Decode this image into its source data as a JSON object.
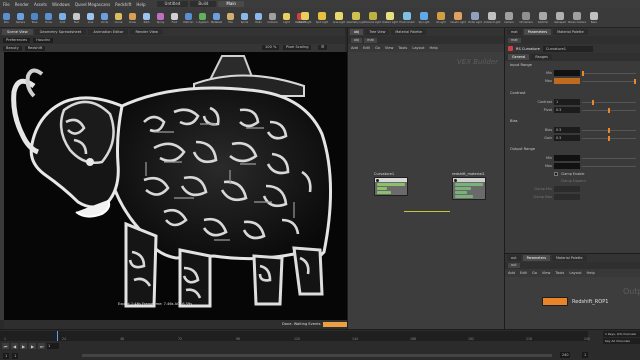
{
  "menubar": {
    "items": [
      "File",
      "Render",
      "Assets",
      "Windows",
      "Qunel Megascans",
      "Redshift",
      "Help"
    ],
    "tabs": [
      "Untitled",
      "Build",
      "Main"
    ]
  },
  "shelf": {
    "tools": [
      {
        "label": "Box",
        "icon": "box-icon",
        "color": "#5a8fd0"
      },
      {
        "label": "Sphere",
        "icon": "sphere-icon",
        "color": "#6aa0e0"
      },
      {
        "label": "Tube",
        "icon": "tube-icon",
        "color": "#4f86c8"
      },
      {
        "label": "Torus",
        "icon": "torus-icon",
        "color": "#5a8fd0"
      },
      {
        "label": "Grid",
        "icon": "grid-icon",
        "color": "#7ab0e8"
      },
      {
        "label": "Null",
        "icon": "null-icon",
        "color": "#c8c8c8"
      },
      {
        "label": "Line",
        "icon": "line-icon",
        "color": "#9cc4ee"
      },
      {
        "label": "Circle",
        "icon": "circle-icon",
        "color": "#6aa0e0"
      },
      {
        "label": "Curve",
        "icon": "curve-icon",
        "color": "#d8c060"
      },
      {
        "label": "Draw",
        "icon": "draw-icon",
        "color": "#d8a050"
      },
      {
        "label": "Path",
        "icon": "path-icon",
        "color": "#9cc4ee"
      },
      {
        "label": "Spray",
        "icon": "spray-icon",
        "color": "#c070c0"
      },
      {
        "label": "Font",
        "icon": "font-icon",
        "color": "#d0d0d0"
      },
      {
        "label": "Platonic",
        "icon": "platonic-icon",
        "color": "#5a8fd0"
      },
      {
        "label": "L-System",
        "icon": "lsystem-icon",
        "color": "#60b060"
      },
      {
        "label": "Metaball",
        "icon": "metaball-icon",
        "color": "#6aa0e0"
      },
      {
        "label": "File",
        "icon": "file-icon",
        "color": "#d0b070"
      },
      {
        "label": "Spiral",
        "icon": "spiral-icon",
        "color": "#8ab8e8"
      },
      {
        "label": "Helix",
        "icon": "helix-icon",
        "color": "#8ab8e8"
      },
      {
        "label": "Camera",
        "icon": "camera-icon",
        "color": "#a0a0a0"
      },
      {
        "label": "Light",
        "icon": "light-icon",
        "color": "#e8d060"
      },
      {
        "label": "Redshift",
        "icon": "redshift-icon",
        "color": "#d04040"
      }
    ],
    "right_tools": [
      {
        "label": "Point Light",
        "color": "#e8d060"
      },
      {
        "label": "Spot Light",
        "color": "#e8c040"
      },
      {
        "label": "Area Light",
        "color": "#e8d870"
      },
      {
        "label": "Geometry Light",
        "color": "#d0c050"
      },
      {
        "label": "Volume Light",
        "color": "#c0b040"
      },
      {
        "label": "Distant Light",
        "color": "#e8e080"
      },
      {
        "label": "Environment",
        "color": "#80c0e0"
      },
      {
        "label": "Sky Light",
        "color": "#60a8e8"
      },
      {
        "label": "GI Light",
        "color": "#d0a040"
      },
      {
        "label": "Caustic Light",
        "color": "#e0a060"
      },
      {
        "label": "Portal Light",
        "color": "#90a0c0"
      },
      {
        "label": "Ambient Light",
        "color": "#c0c0c0"
      },
      {
        "label": "Camera",
        "color": "#a0a0a0"
      },
      {
        "label": "VR Camera",
        "color": "#909090"
      },
      {
        "label": "Switcher",
        "color": "#a8a8a8"
      },
      {
        "label": "Gamepad",
        "color": "#b0b0b0"
      },
      {
        "label": "Stereo Camera",
        "color": "#a0a0a0"
      },
      {
        "label": "Basic",
        "color": "#c0c0c0"
      }
    ]
  },
  "viewport": {
    "tabs": [
      "Scene View",
      "Geometry Spreadsheet",
      "Animation Editor",
      "Render View"
    ],
    "address": [
      "Preferences",
      "Houdini"
    ],
    "camera": "Beauty",
    "aov": "Redshift",
    "zoom": "100 %",
    "scaling": "Pixel Scaling",
    "caption": "Export 1:46s  Frametime: 7.46s  AO: 6.59s",
    "status": "Done. Waiting Events",
    "progress": 1.0
  },
  "timeline": {
    "ticks": [
      "1",
      "24",
      "48",
      "72",
      "96",
      "120",
      "144",
      "168",
      "192",
      "216",
      "240"
    ],
    "frame": "1",
    "start": "1",
    "end": "1",
    "range_start": "1",
    "range_end": "240",
    "right_rows": [
      "1 Keys, 0/0 channels",
      "Key All Channels"
    ]
  },
  "network": {
    "tabs": [
      "obj",
      "Tree View",
      "Material Palette"
    ],
    "path": [
      "obj",
      "mat"
    ],
    "menu": [
      "Add",
      "Edit",
      "Go",
      "View",
      "Tools",
      "Layout",
      "Help"
    ],
    "watermark": "VEX Builder",
    "nodes": [
      {
        "name": "Curvature1",
        "color": "#6e6e6e"
      },
      {
        "name": "redshift_material1",
        "color": "#6e6e6e"
      }
    ]
  },
  "params": {
    "tabs": [
      "mat",
      "Parameters",
      "Material Palette"
    ],
    "path": [
      "mat"
    ],
    "node_type": "RS Curvature",
    "node_name": "Curvature1",
    "param_tabs": [
      "General",
      "Ranges"
    ],
    "sections": {
      "input": "Input Range",
      "contrast_sec": "Contrast",
      "bias_sec": "Bias",
      "output": "Output Range"
    },
    "rows": {
      "min": {
        "label": "Min",
        "value": "0"
      },
      "max": {
        "label": "Max",
        "value": "1"
      },
      "contrast": {
        "label": "Contrast",
        "value": "1"
      },
      "pivot": {
        "label": "Pivot",
        "value": "0.5"
      },
      "bias": {
        "label": "Bias",
        "value": "0.5"
      },
      "gain": {
        "label": "Gain",
        "value": "0.5"
      },
      "out_min": {
        "label": "Min",
        "value": "0"
      },
      "out_max": {
        "label": "Max",
        "value": "1"
      },
      "clamp": {
        "label": "Clamp Enable"
      },
      "clamp_exp": {
        "label": "Clamp Expand"
      },
      "clamp_min": {
        "label": "Clamp Min"
      },
      "clamp_max": {
        "label": "Clamp Max"
      }
    },
    "swatch_orange": "#c06a20",
    "swatch_dark": "#111111"
  },
  "network2": {
    "tabs": [
      "out",
      "Parameters",
      "Material Palette"
    ],
    "path": [
      "out"
    ],
    "menu": [
      "Add",
      "Edit",
      "Go",
      "View",
      "Tools",
      "Layout",
      "Help"
    ],
    "watermark": "Output",
    "rop_name": "Redshift_ROP1"
  }
}
